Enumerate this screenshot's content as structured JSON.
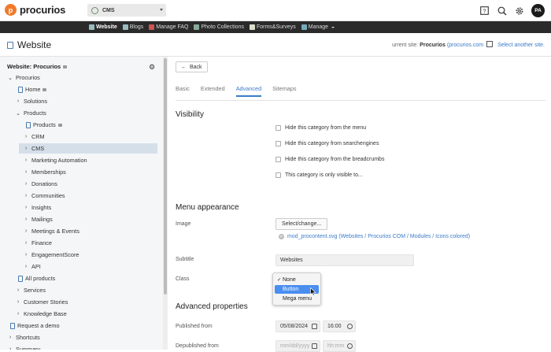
{
  "app": {
    "logo_text": "procurios",
    "logo_letter": "p"
  },
  "site_selector": {
    "value": "CMS"
  },
  "user": {
    "initials": "PA"
  },
  "top_icons": [
    "help-icon",
    "search-icon",
    "gear-icon"
  ],
  "nav": {
    "items": [
      {
        "label": "Website",
        "active": true
      },
      {
        "label": "Blogs"
      },
      {
        "label": "Manage FAQ"
      },
      {
        "label": "Photo Collections"
      },
      {
        "label": "Forms&Surveys"
      },
      {
        "label": "Manage"
      }
    ]
  },
  "page": {
    "title": "Website",
    "current_site_prefix": "urrent site:",
    "current_site_name": "Procurios",
    "current_site_link": "(procurios.com",
    "select_another": "Select another site."
  },
  "sidebar": {
    "heading": "Website: Procurios",
    "tree": [
      {
        "label": "Procurios",
        "chev": "⌄",
        "page": false
      },
      {
        "label": "Home",
        "chev": "",
        "page": true,
        "lock": true
      },
      {
        "label": "Solutions",
        "chev": "›",
        "page": false
      },
      {
        "label": "Products",
        "chev": "⌄",
        "page": false
      },
      {
        "label": "Products",
        "chev": "",
        "page": true,
        "lock": true
      },
      {
        "label": "CRM",
        "chev": "›",
        "page": false
      },
      {
        "label": "CMS",
        "chev": "›",
        "page": false,
        "selected": true
      },
      {
        "label": "Marketing Automation",
        "chev": "›",
        "page": false
      },
      {
        "label": "Memberships",
        "chev": "›",
        "page": false
      },
      {
        "label": "Donations",
        "chev": "›",
        "page": false
      },
      {
        "label": "Communities",
        "chev": "›",
        "page": false
      },
      {
        "label": "Insights",
        "chev": "›",
        "page": false
      },
      {
        "label": "Mailings",
        "chev": "›",
        "page": false
      },
      {
        "label": "Meetings & Events",
        "chev": "›",
        "page": false
      },
      {
        "label": "Finance",
        "chev": "›",
        "page": false
      },
      {
        "label": "EngagementScore",
        "chev": "›",
        "page": false
      },
      {
        "label": "API",
        "chev": "›",
        "page": false
      },
      {
        "label": "All products",
        "chev": "",
        "page": true
      },
      {
        "label": "Services",
        "chev": "›",
        "page": false
      },
      {
        "label": "Customer Stories",
        "chev": "›",
        "page": false
      },
      {
        "label": "Knowledge Base",
        "chev": "›",
        "page": false
      },
      {
        "label": "Request a demo",
        "chev": "",
        "page": true
      },
      {
        "label": "Shortcuts",
        "chev": "›",
        "page": false
      },
      {
        "label": "Summary",
        "chev": "›",
        "page": false
      }
    ]
  },
  "main": {
    "back": "Back",
    "tabs": [
      "Basic",
      "Extended",
      "Advanced",
      "Sitemaps"
    ],
    "active_tab": "Advanced",
    "visibility": {
      "title": "Visibility",
      "options": [
        "Hide this category from the menu",
        "Hide this category from searchengines",
        "Hide this category from the breadcrumbs",
        "This category is only visible to..."
      ]
    },
    "menu_appearance": {
      "title": "Menu appearance",
      "image_label": "Image",
      "select_button": "Select/change...",
      "file": "mod_procontent.svg (Websites / Procurios COM / Modules / Icons colored)",
      "subtitle_label": "Subtitle",
      "subtitle_value": "Websites",
      "class_label": "Class",
      "class_options": [
        "None",
        "Button",
        "Mega menu"
      ],
      "class_selected": "None",
      "class_highlighted": "Button"
    },
    "advanced": {
      "title": "Advanced properties",
      "published_label": "Published from",
      "published_date": "05/08/2024",
      "published_time": "16:00",
      "depublished_label": "Depublished from",
      "depublished_date_placeholder": "mm/dd/yyyy",
      "depublished_time_placeholder": "hh:mm"
    }
  }
}
